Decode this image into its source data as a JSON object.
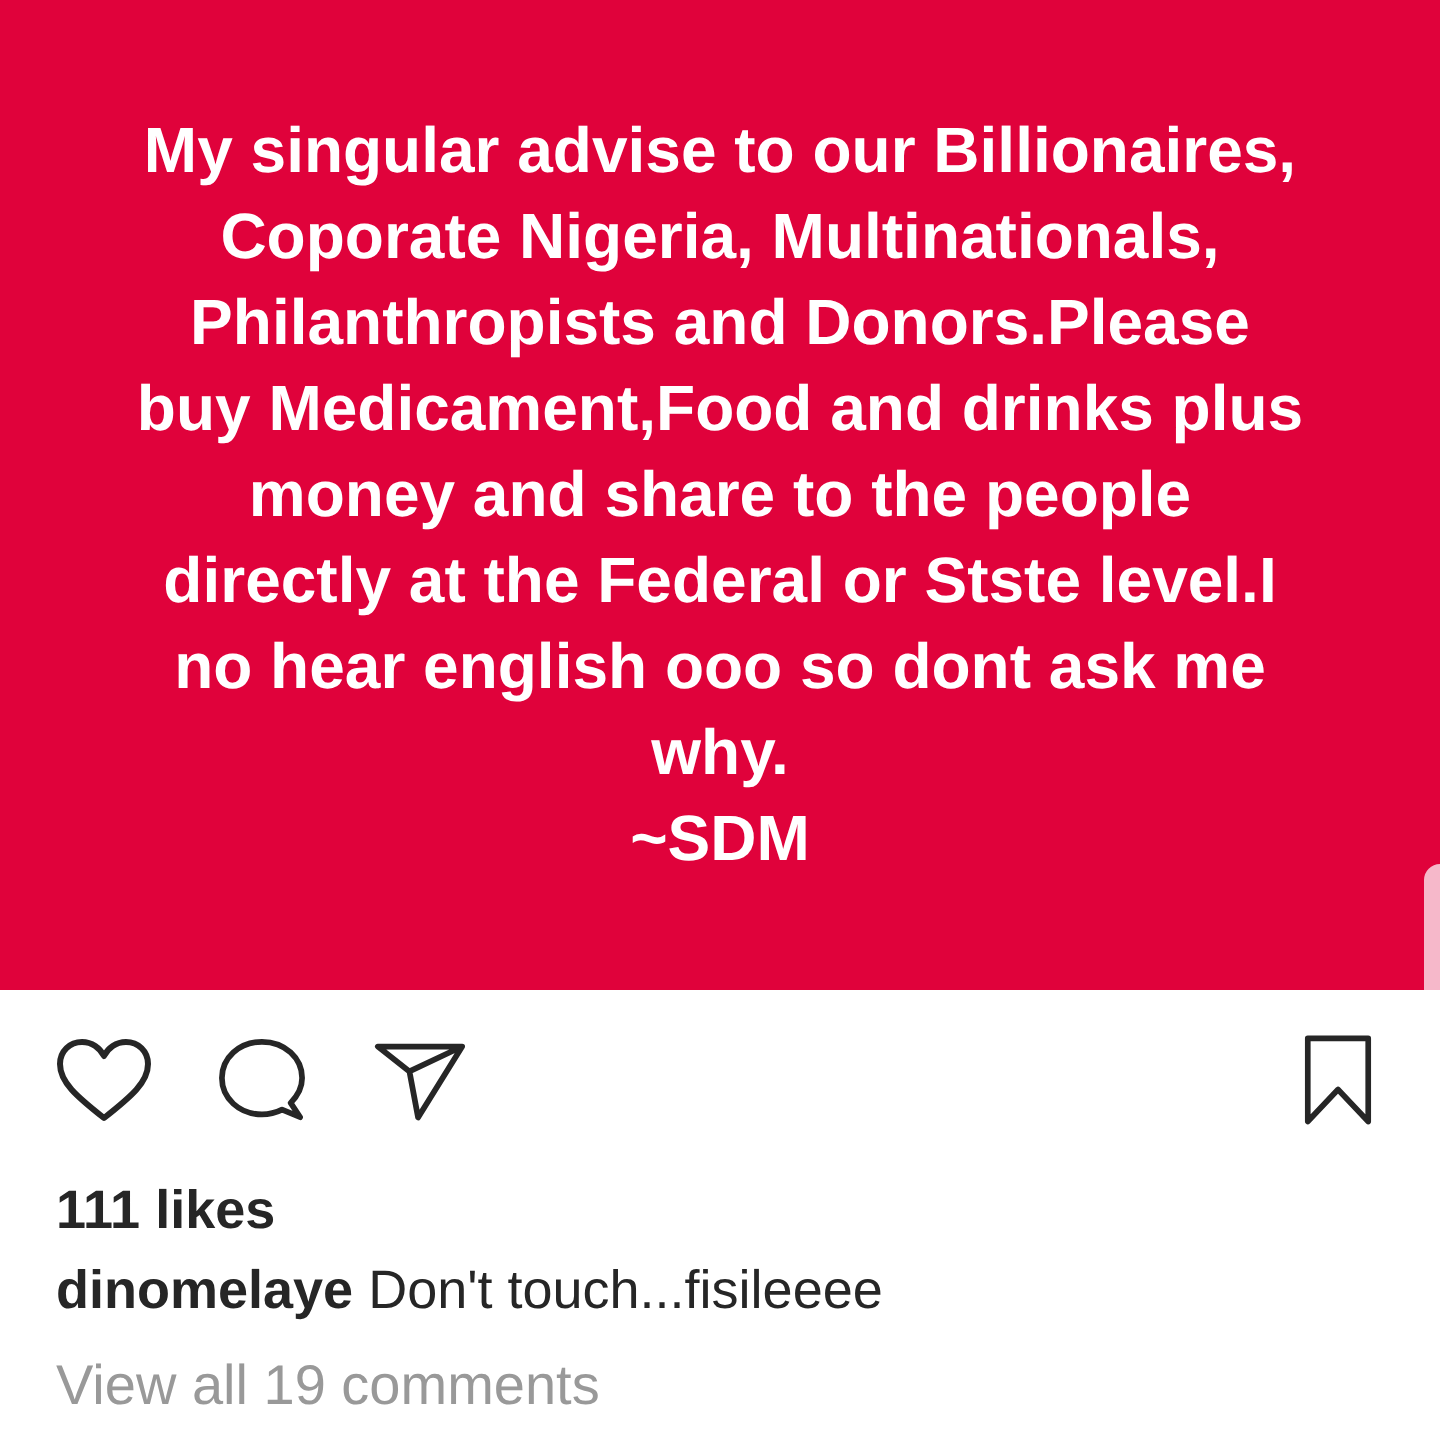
{
  "post": {
    "image_text": "My singular advise to our Billionaires, Coporate Nigeria, Multinationals, Philanthropists and Donors.Please buy Medicament,Food and drinks plus money and share to the people directly at the Federal or Stste level.I no hear english ooo so dont ask me why.\n~SDM"
  },
  "actions": {
    "liked": false,
    "saved": false
  },
  "likes": "111 likes",
  "caption": "**dinomelaye** Don't touch...fisileeee",
  "comments_link": "View all 19 comments"
}
